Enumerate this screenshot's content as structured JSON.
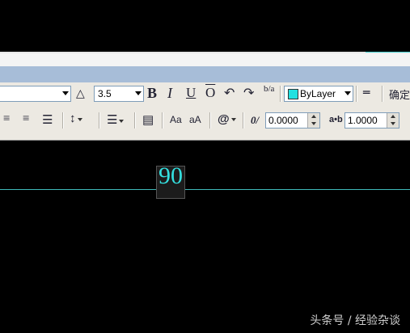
{
  "toolbar": {
    "font_size": "3.5",
    "bold": "B",
    "italic": "I",
    "underline": "U",
    "overline": "O",
    "stack": "b/a",
    "color_value": "ByLayer",
    "color_swatch": "#22e0e0",
    "ok_label": "确定",
    "case_upper": "Aa",
    "case_lower": "aA",
    "symbol": "@",
    "oblique_label": "0/",
    "oblique_value": "0.0000",
    "tracking_label": "a•b",
    "tracking_value": "1.0000"
  },
  "canvas": {
    "mtext_value": "90"
  },
  "watermark": "头条号 / 经验杂谈"
}
